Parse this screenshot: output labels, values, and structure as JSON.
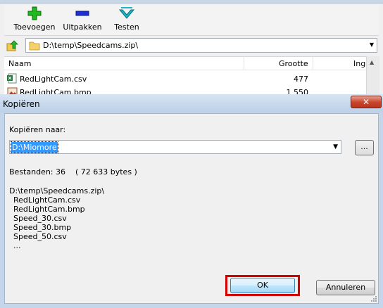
{
  "toolbar": {
    "add_label": "Toevoegen",
    "extract_label": "Uitpakken",
    "test_label": "Testen"
  },
  "address": {
    "path": "D:\\temp\\Speedcams.zip\\"
  },
  "filelist": {
    "columns": [
      "Naam",
      "Grootte",
      "Ing"
    ],
    "rows": [
      {
        "name": "RedLightCam.csv",
        "size": "477"
      },
      {
        "name": "RedLightCam.bmp",
        "size": "1 550"
      }
    ]
  },
  "dialog": {
    "title": "Kopiëren",
    "close_label": "✕",
    "copy_to_label": "Kopiëren naar:",
    "destination": "D:\\Miomore",
    "browse_label": "...",
    "files_summary": "Bestanden: 36    ( 72 633 bytes )",
    "archive_path": "D:\\temp\\Speedcams.zip\\",
    "files": [
      "RedLightCam.csv",
      "RedLightCam.bmp",
      "Speed_30.csv",
      "Speed_30.bmp",
      "Speed_50.csv",
      "..."
    ],
    "ok_label": "OK",
    "cancel_label": "Annuleren"
  },
  "colors": {
    "highlight_border": "#d40000",
    "selection": "#3399ff"
  }
}
